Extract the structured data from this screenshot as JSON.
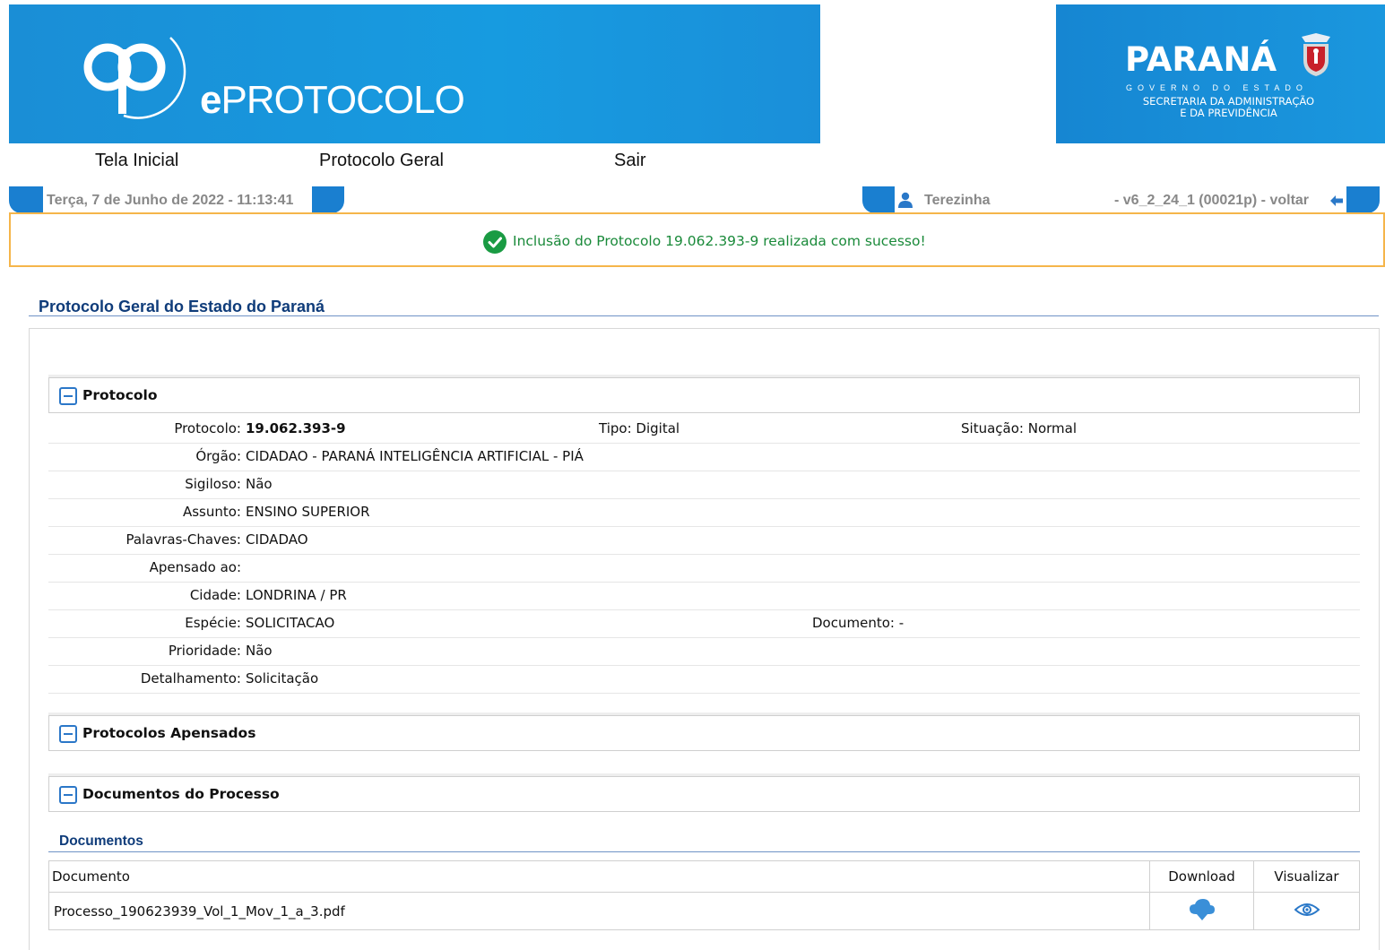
{
  "brand": {
    "app_name_bold": "e",
    "app_name_rest": "PROTOCOLO",
    "state_name": "PARANÁ",
    "gov_line": "GOVERNO DO ESTADO",
    "secretariat_line1": "SECRETARIA DA ADMINISTRAÇÃO",
    "secretariat_line2": "E DA PREVIDÊNCIA"
  },
  "menu": {
    "home": "Tela Inicial",
    "general": "Protocolo Geral",
    "exit": "Sair"
  },
  "infobar": {
    "datetime": "Terça, 7 de Junho de 2022 - 11:13:41",
    "user": "Terezinha",
    "version": "- v6_2_24_1 (00021p) - voltar"
  },
  "success_message": "Inclusão do Protocolo 19.062.393-9 realizada com sucesso!",
  "page_title": "Protocolo Geral do Estado do Paraná",
  "sections": {
    "protocolo": "Protocolo",
    "apensados": "Protocolos Apensados",
    "documentos": "Documentos do Processo"
  },
  "details": {
    "protocolo_label": "Protocolo:",
    "protocolo_value": "19.062.393-9",
    "tipo_label": "Tipo:",
    "tipo_value": "Digital",
    "situacao_label": "Situação:",
    "situacao_value": "Normal",
    "orgao_label": "Órgão:",
    "orgao_value": "CIDADAO - PARANÁ INTELIGÊNCIA ARTIFICIAL - PIÁ",
    "sigiloso_label": "Sigiloso:",
    "sigiloso_value": "Não",
    "assunto_label": "Assunto:",
    "assunto_value": "ENSINO SUPERIOR",
    "palavras_label": "Palavras-Chaves:",
    "palavras_value": "CIDADAO",
    "apensado_label": "Apensado ao:",
    "apensado_value": "",
    "cidade_label": "Cidade:",
    "cidade_value": "LONDRINA / PR",
    "especie_label": "Espécie:",
    "especie_value": "SOLICITACAO",
    "documento_label": "Documento:",
    "documento_value": "-",
    "prioridade_label": "Prioridade:",
    "prioridade_value": "Não",
    "detalhamento_label": "Detalhamento:",
    "detalhamento_value": "Solicitação"
  },
  "documents": {
    "title": "Documentos",
    "col_document": "Documento",
    "col_download": "Download",
    "col_view": "Visualizar",
    "rows": [
      {
        "name": "Processo_190623939_Vol_1_Mov_1_a_3.pdf",
        "download_icon": "cloud-download-icon",
        "view_icon": "eye-icon"
      }
    ]
  },
  "colors": {
    "banner_blue": "#179be0",
    "tab_blue": "#1a7fd0",
    "title_navy": "#0f3c7a",
    "success_green": "#1a8a3a",
    "success_border": "#f5b54a"
  }
}
